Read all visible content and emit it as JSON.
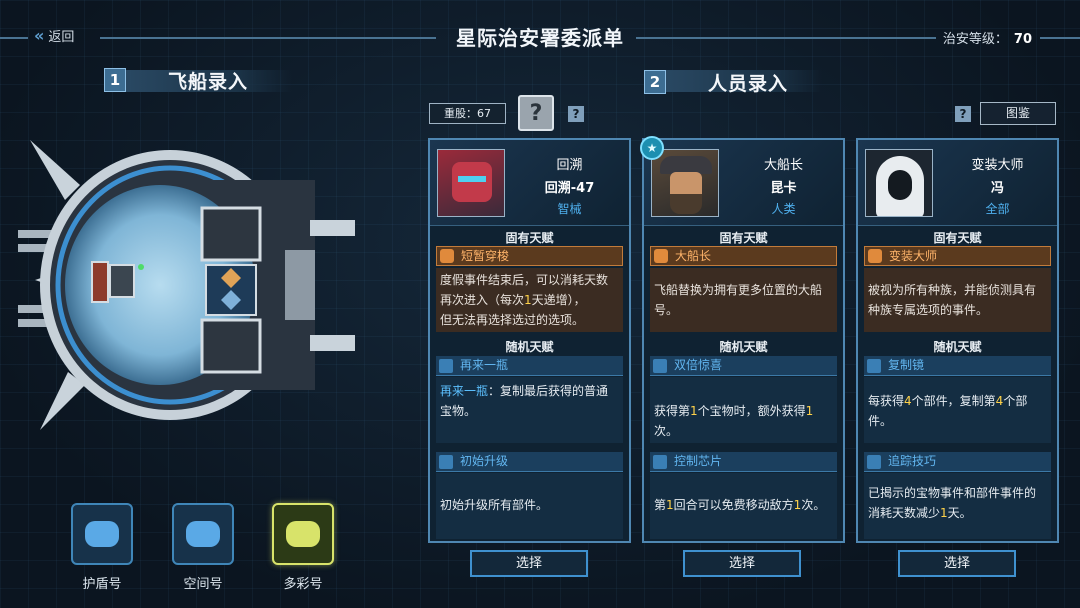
{
  "header": {
    "back_label": "返回",
    "title": "星际治安署委派单",
    "level_label": "治安等级：",
    "level_value": "70"
  },
  "sections": [
    {
      "number": "1",
      "title": "飞船录入"
    },
    {
      "number": "2",
      "title": "人员录入"
    }
  ],
  "ships": [
    {
      "label": "护盾号",
      "color": "#5aa9e6"
    },
    {
      "label": "空间号",
      "color": "#5aa9e6"
    },
    {
      "label": "多彩号",
      "color": "#d8e36a",
      "active": true
    }
  ],
  "toolbar": {
    "weight_label": "重股：67",
    "unknown_glyph": "?",
    "help_glyph": "?",
    "codex_label": "图鉴"
  },
  "cards": [
    {
      "name1": "回溯",
      "name2": "回溯-47",
      "race": "智械",
      "innate_header": "固有天赋",
      "innate_name": "短暂穿梭",
      "innate_desc": [
        "度假事件结束后，可以消耗天数",
        "再次进入（每次",
        "1",
        "天递增），",
        "但无法再选择选过的选项。"
      ],
      "random_header": "随机天赋",
      "t1_name": "再来一瓶",
      "t1_desc_a": "再来一瓶",
      "t1_desc_b": "：复制最后获得的普通宝物。",
      "t2_name": "初始升级",
      "t2_desc": "初始升级所有部件。"
    },
    {
      "name1": "大船长",
      "name2": "昆卡",
      "race": "人类",
      "innate_header": "固有天赋",
      "innate_name": "大船长",
      "innate_desc_full": "飞船替换为拥有更多位置的大船号。",
      "random_header": "随机天赋",
      "t1_name": "双倍惊喜",
      "t1_desc": [
        "获得第",
        "1",
        "个宝物时，额外获得",
        "1",
        "次。"
      ],
      "t2_name": "控制芯片",
      "t2_desc": [
        "第",
        "1",
        "回合可以免费移动敌方",
        "1",
        "次。"
      ]
    },
    {
      "name1": "变装大师",
      "name2": "冯",
      "race": "全部",
      "innate_header": "固有天赋",
      "innate_name": "变装大师",
      "innate_desc_full": "被视为所有种族，并能侦测具有种族专属选项的事件。",
      "random_header": "随机天赋",
      "t1_name": "复制镜",
      "t1_desc": [
        "每获得",
        "4",
        "个部件，复制第",
        "4",
        "个部件。"
      ],
      "t2_name": "追踪技巧",
      "t2_desc": [
        "已揭示的宝物事件和部件事件的消耗天数减少",
        "1",
        "天。"
      ]
    }
  ],
  "select_label": "选择",
  "colors": {
    "accent": "#4f87b2",
    "innate": "#c27b3a",
    "highlight": "#ffd24a"
  }
}
